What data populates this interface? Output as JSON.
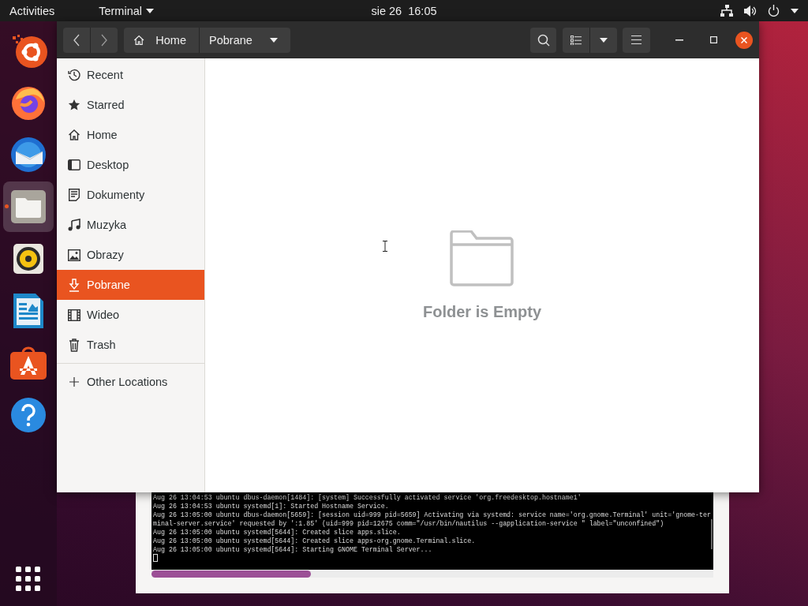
{
  "top_bar": {
    "activities": "Activities",
    "app_menu": "Terminal",
    "clock": "sie 26  16:05"
  },
  "dock": [
    {
      "kind": "ubuntu",
      "active": false
    },
    {
      "kind": "firefox",
      "active": false
    },
    {
      "kind": "thunderbird",
      "active": false
    },
    {
      "kind": "files",
      "active": true
    },
    {
      "kind": "rhythmbox",
      "active": false
    },
    {
      "kind": "writer",
      "active": false
    },
    {
      "kind": "software",
      "active": false
    },
    {
      "kind": "help",
      "active": false
    }
  ],
  "files_window": {
    "path": [
      {
        "kind": "home",
        "label": "Home"
      },
      {
        "kind": "folder",
        "label": "Pobrane"
      }
    ],
    "sidebar": [
      {
        "kind": "recent",
        "label": "Recent",
        "selected": false
      },
      {
        "kind": "starred",
        "label": "Starred",
        "selected": false
      },
      {
        "kind": "home",
        "label": "Home",
        "selected": false
      },
      {
        "kind": "desktop",
        "label": "Desktop",
        "selected": false
      },
      {
        "kind": "documents",
        "label": "Dokumenty",
        "selected": false
      },
      {
        "kind": "music",
        "label": "Muzyka",
        "selected": false
      },
      {
        "kind": "pictures",
        "label": "Obrazy",
        "selected": false
      },
      {
        "kind": "downloads",
        "label": "Pobrane",
        "selected": true
      },
      {
        "kind": "videos",
        "label": "Wideo",
        "selected": false
      },
      {
        "kind": "trash",
        "label": "Trash",
        "selected": false
      }
    ],
    "other_locations": "Other Locations",
    "empty_message": "Folder is Empty"
  },
  "terminal": {
    "lines": [
      "Aug 26 13:04:53 ubuntu dbus-daemon[1484]: [system] Successfully activated service 'org.freedesktop.hostname1'",
      "Aug 26 13:04:53 ubuntu systemd[1]: Started Hostname Service.",
      "Aug 26 13:05:00 ubuntu dbus-daemon[5659]: [session uid=999 pid=5659] Activating via systemd: service name='org.gnome.Terminal' unit='gnome-ter",
      "minal-server.service' requested by ':1.85' (uid=999 pid=12675 comm=\"/usr/bin/nautilus --gapplication-service \" label=\"unconfined\")",
      "Aug 26 13:05:00 ubuntu systemd[5644]: Created slice apps.slice.",
      "Aug 26 13:05:00 ubuntu systemd[5644]: Created slice apps-org.gnome.Terminal.slice.",
      "Aug 26 13:05:00 ubuntu systemd[5644]: Starting GNOME Terminal Server..."
    ]
  }
}
